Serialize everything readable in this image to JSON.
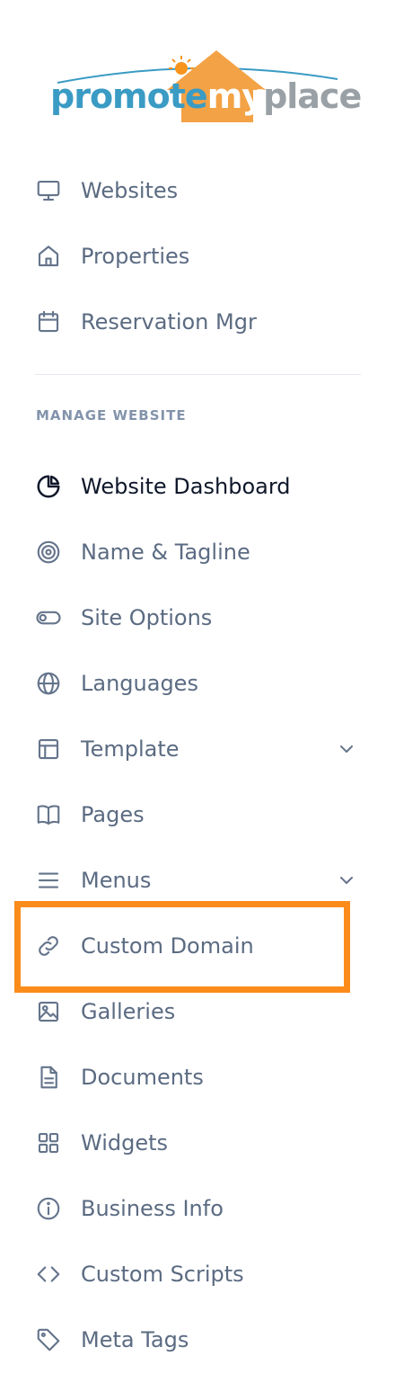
{
  "logo": {
    "word1": "promote",
    "word2": "my",
    "word3": "place",
    "colors": {
      "blue": "#3a9bc4",
      "orange": "#f3a245",
      "gray": "#9aa1a6",
      "sun": "#f7941d"
    }
  },
  "top_nav": [
    {
      "label": "Websites",
      "icon": "monitor-icon"
    },
    {
      "label": "Properties",
      "icon": "home-icon"
    },
    {
      "label": "Reservation Mgr",
      "icon": "calendar-icon"
    }
  ],
  "section": {
    "title": "MANAGE WEBSITE"
  },
  "manage_nav": [
    {
      "label": "Website Dashboard",
      "icon": "pie-chart-icon",
      "active": true
    },
    {
      "label": "Name & Tagline",
      "icon": "target-icon"
    },
    {
      "label": "Site Options",
      "icon": "toggle-icon"
    },
    {
      "label": "Languages",
      "icon": "globe-icon"
    },
    {
      "label": "Template",
      "icon": "layout-icon",
      "has_chevron": true
    },
    {
      "label": "Pages",
      "icon": "book-open-icon"
    },
    {
      "label": "Menus",
      "icon": "menu-icon",
      "has_chevron": true
    },
    {
      "label": "Custom Domain",
      "icon": "link-icon",
      "highlighted": true
    },
    {
      "label": "Galleries",
      "icon": "image-icon"
    },
    {
      "label": "Documents",
      "icon": "document-icon"
    },
    {
      "label": "Widgets",
      "icon": "grid-icon"
    },
    {
      "label": "Business Info",
      "icon": "info-icon"
    },
    {
      "label": "Custom Scripts",
      "icon": "code-icon"
    },
    {
      "label": "Meta Tags",
      "icon": "tag-icon"
    }
  ],
  "highlight_color": "#fb8c1b"
}
